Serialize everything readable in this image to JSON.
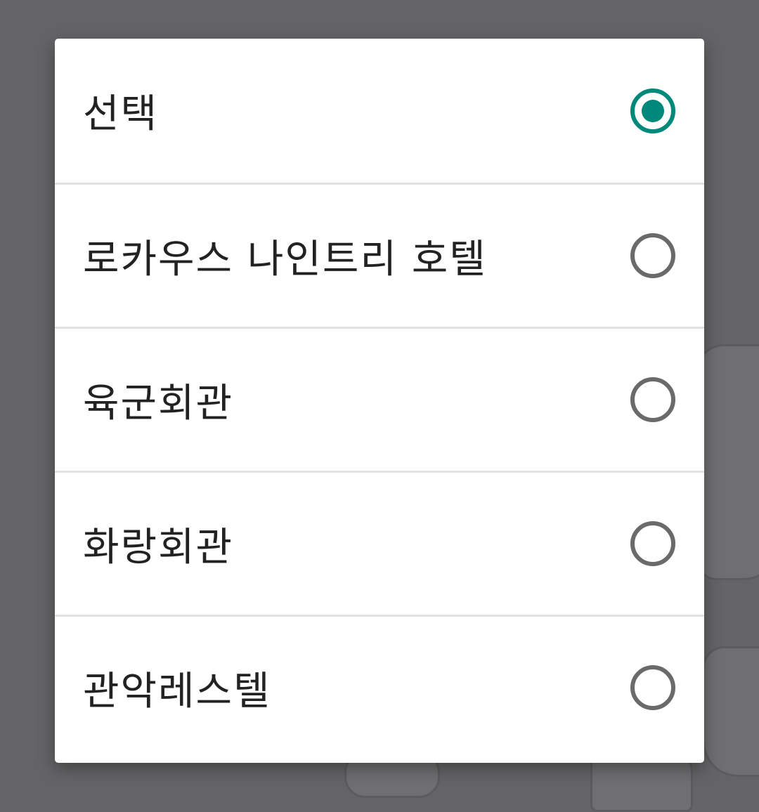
{
  "dialog": {
    "options": [
      {
        "label": "선택",
        "selected": true
      },
      {
        "label": "로카우스 나인트리 호텔",
        "selected": false
      },
      {
        "label": "육군회관",
        "selected": false
      },
      {
        "label": "화랑회관",
        "selected": false
      },
      {
        "label": "관악레스텔",
        "selected": false
      }
    ]
  },
  "colors": {
    "accent": "#00897b",
    "radio_unchecked": "#6a6a6a",
    "scrim": "#646466",
    "divider": "#e2e2e2"
  }
}
